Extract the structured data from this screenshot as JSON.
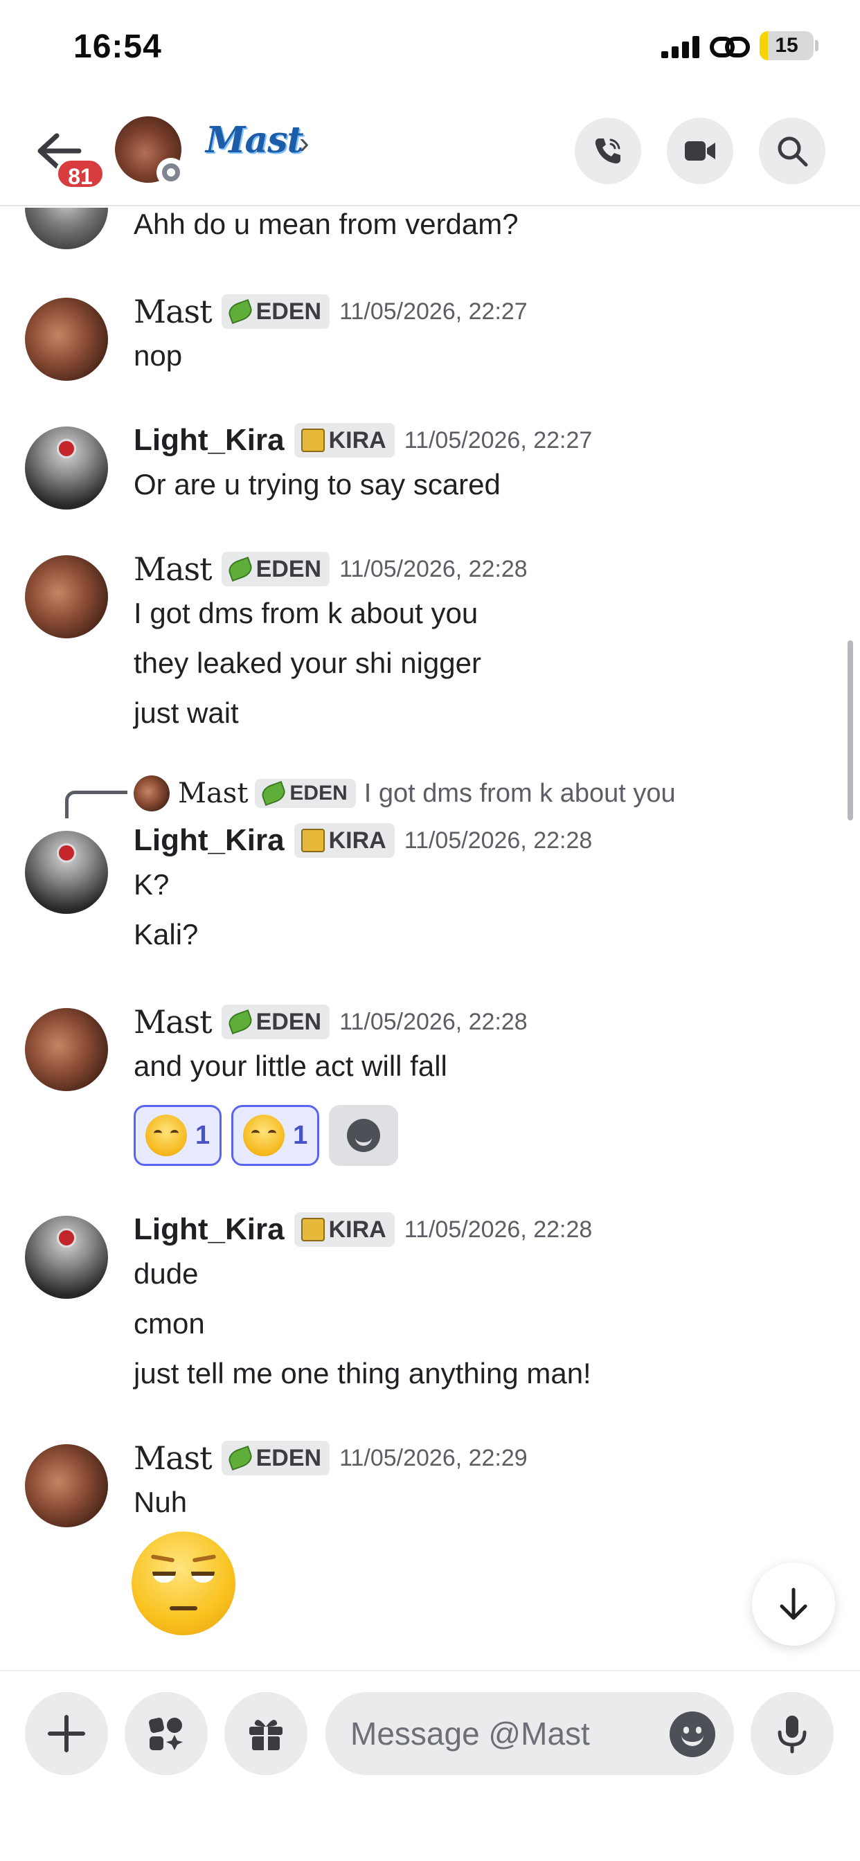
{
  "status_bar": {
    "time": "16:54",
    "battery": "15",
    "battery_level": 0.15
  },
  "header": {
    "unread_badge": "81",
    "contact_name": "Mast",
    "chevron": "›"
  },
  "messages": {
    "top_line": "Ahh do u mean from verdam?",
    "m1": {
      "author": "Mast",
      "tag": "EDEN",
      "time": "11/05/2026, 22:27",
      "lines": [
        "nop"
      ]
    },
    "m2": {
      "author": "Light_Kira",
      "tag": "KIRA",
      "time": "11/05/2026, 22:27",
      "lines": [
        "Or are u trying to say scared"
      ]
    },
    "m3": {
      "author": "Mast",
      "tag": "EDEN",
      "time": "11/05/2026, 22:28",
      "lines": [
        "I got dms from k about you",
        "they leaked your shi nigger",
        "just wait"
      ]
    },
    "reply": {
      "author": "Mast",
      "tag": "EDEN",
      "text": "I got dms from k about you"
    },
    "m4": {
      "author": "Light_Kira",
      "tag": "KIRA",
      "time": "11/05/2026, 22:28",
      "lines": [
        "K?",
        "Kali?"
      ]
    },
    "m5": {
      "author": "Mast",
      "tag": "EDEN",
      "time": "11/05/2026, 22:28",
      "lines": [
        "and your little act will fall"
      ],
      "reactions": [
        {
          "emoji": "joy",
          "count": "1"
        },
        {
          "emoji": "rofl",
          "count": "1"
        }
      ]
    },
    "m6": {
      "author": "Light_Kira",
      "tag": "KIRA",
      "time": "11/05/2026, 22:28",
      "lines": [
        "dude",
        "cmon",
        "just tell me one thing anything man!"
      ]
    },
    "m7": {
      "author": "Mast",
      "tag": "EDEN",
      "time": "11/05/2026, 22:29",
      "lines": [
        "Nuh"
      ],
      "emoji": "pensive-face"
    }
  },
  "composer": {
    "placeholder": "Message @Mast"
  },
  "icons": {
    "back": "arrow-left-icon",
    "call": "phone-icon",
    "video": "video-camera-icon",
    "search": "search-icon",
    "add": "plus-icon",
    "apps": "apps-icon",
    "gift": "gift-icon",
    "emoji": "emoji-icon",
    "mic": "microphone-icon",
    "jump": "arrow-down-icon"
  },
  "colors": {
    "badge": "#d83c3e",
    "reaction_border": "#5865f2",
    "reaction_count": "#4752c4",
    "name_link": "#1d5da8"
  }
}
